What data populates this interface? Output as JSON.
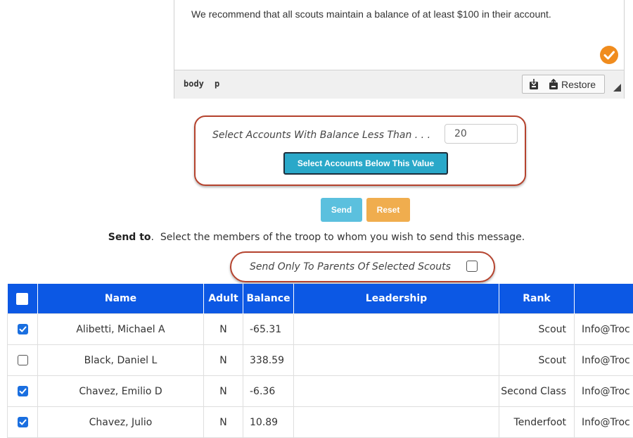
{
  "editor": {
    "text": "We recommend that all scouts maintain a balance of at least $100 in their account.",
    "path": [
      "body",
      "p"
    ],
    "restore_label": "Restore",
    "icons": {
      "save": "save-disk-icon",
      "restore": "restore-icon",
      "resize": "resize-handle-icon",
      "status": "check-circle-icon"
    },
    "status_color": "#f08c1e"
  },
  "select_accounts": {
    "label": "Select Accounts With Balance Less Than . . .",
    "value": "20",
    "button_label": "Select Accounts Below This Value"
  },
  "actions": {
    "send_label": "Send",
    "reset_label": "Reset"
  },
  "send_to": {
    "label": "Send to",
    "description": "Select the members of the troop to whom you wish to send this message."
  },
  "parents_only": {
    "label": "Send Only To Parents Of Selected Scouts",
    "checked": false
  },
  "table": {
    "header_color": "#0c58e4",
    "columns": [
      "Name",
      "Adult",
      "Balance",
      "Leadership",
      "Rank",
      ""
    ],
    "rows": [
      {
        "checked": true,
        "name": "Alibetti, Michael A",
        "adult": "N",
        "balance": "-65.31",
        "leadership": "",
        "rank": "Scout",
        "email": "Info@Troc"
      },
      {
        "checked": false,
        "name": "Black, Daniel L",
        "adult": "N",
        "balance": "338.59",
        "leadership": "",
        "rank": "Scout",
        "email": "Info@Troc"
      },
      {
        "checked": true,
        "name": "Chavez, Emilio D",
        "adult": "N",
        "balance": "-6.36",
        "leadership": "",
        "rank": "Second Class",
        "email": "Info@Troc"
      },
      {
        "checked": true,
        "name": "Chavez, Julio",
        "adult": "N",
        "balance": "10.89",
        "leadership": "",
        "rank": "Tenderfoot",
        "email": "Info@Troc"
      }
    ]
  }
}
